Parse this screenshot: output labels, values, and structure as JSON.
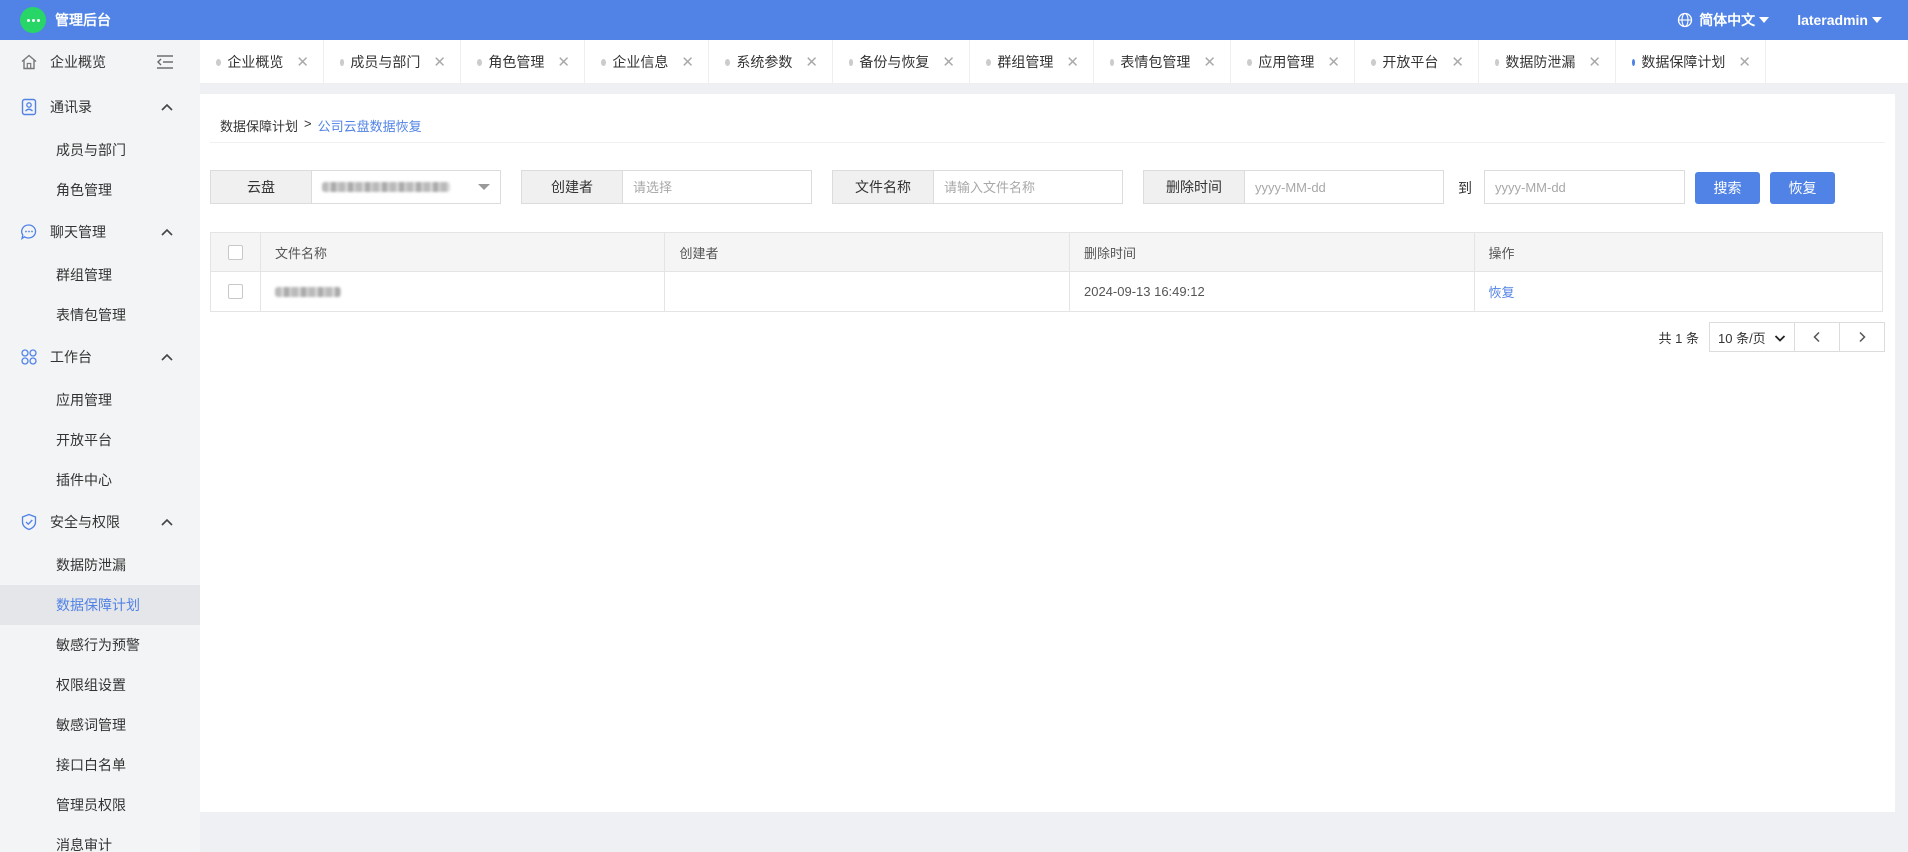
{
  "app": {
    "title": "管理后台"
  },
  "topbar": {
    "language": "简体中文",
    "user": "lateradmin"
  },
  "sidebar": {
    "groups": [
      {
        "label": "企业概览",
        "icon": "home-icon",
        "collapse_icon": "collapse-menu-icon"
      },
      {
        "label": "通讯录",
        "icon": "contacts-icon",
        "items": [
          "成员与部门",
          "角色管理"
        ]
      },
      {
        "label": "聊天管理",
        "icon": "chat-icon",
        "items": [
          "群组管理",
          "表情包管理"
        ]
      },
      {
        "label": "工作台",
        "icon": "workbench-icon",
        "items": [
          "应用管理",
          "开放平台",
          "插件中心"
        ]
      },
      {
        "label": "安全与权限",
        "icon": "shield-icon",
        "items": [
          "数据防泄漏",
          "数据保障计划",
          "敏感行为预警",
          "权限组设置",
          "敏感词管理",
          "接口白名单",
          "管理员权限",
          "消息审计"
        ]
      }
    ],
    "active_item": "数据保障计划"
  },
  "tabs": [
    {
      "label": "企业概览",
      "width": 124
    },
    {
      "label": "成员与部门",
      "width": 137
    },
    {
      "label": "角色管理",
      "width": 124
    },
    {
      "label": "企业信息",
      "width": 124
    },
    {
      "label": "系统参数",
      "width": 124
    },
    {
      "label": "备份与恢复",
      "width": 137
    },
    {
      "label": "群组管理",
      "width": 124
    },
    {
      "label": "表情包管理",
      "width": 137
    },
    {
      "label": "应用管理",
      "width": 124
    },
    {
      "label": "开放平台",
      "width": 124
    },
    {
      "label": "数据防泄漏",
      "width": 137
    },
    {
      "label": "数据保障计划",
      "width": 150,
      "active": true
    }
  ],
  "breadcrumb": {
    "parent": "数据保障计划",
    "separator": ">",
    "current": "公司云盘数据恢复"
  },
  "filters": {
    "cloud_label": "云盘",
    "creator_label": "创建者",
    "creator_placeholder": "请选择",
    "filename_label": "文件名称",
    "filename_placeholder": "请输入文件名称",
    "delete_time_label": "删除时间",
    "date_from_placeholder": "yyyy-MM-dd",
    "to_label": "到",
    "date_to_placeholder": "yyyy-MM-dd",
    "search_button": "搜索",
    "restore_button": "恢复"
  },
  "table": {
    "columns": [
      "文件名称",
      "创建者",
      "删除时间",
      "操作"
    ],
    "rows": [
      {
        "filename": "",
        "creator": "",
        "deleted_at": "2024-09-13 16:49:12",
        "action": "恢复"
      }
    ]
  },
  "pagination": {
    "total": "共 1 条",
    "page_size": "10 条/页"
  },
  "colors": {
    "primary": "#5183e6",
    "logo_green": "#27d667",
    "sidebar_bg": "#f3f4f6"
  }
}
